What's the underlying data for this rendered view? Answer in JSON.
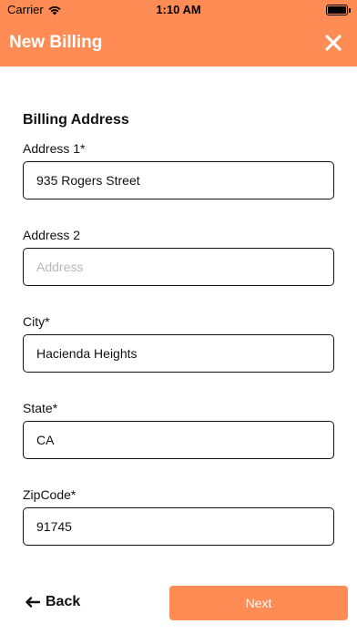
{
  "status_bar": {
    "carrier": "Carrier",
    "time": "1:10 AM",
    "wifi_icon": "wifi-icon",
    "battery_icon": "battery-icon"
  },
  "header": {
    "title": "New Billing",
    "close_icon": "close-icon",
    "background_color": "#ff8c55"
  },
  "form": {
    "section_title": "Billing Address",
    "fields": [
      {
        "label": "Address 1*",
        "value": "935 Rogers Street",
        "placeholder": ""
      },
      {
        "label": "Address 2",
        "value": "",
        "placeholder": "Address"
      },
      {
        "label": "City*",
        "value": "Hacienda Heights",
        "placeholder": ""
      },
      {
        "label": "State*",
        "value": "CA",
        "placeholder": ""
      },
      {
        "label": "ZipCode*",
        "value": "91745",
        "placeholder": ""
      }
    ]
  },
  "footer": {
    "back_label": "Back",
    "back_icon": "arrow-left-icon",
    "next_label": "Next",
    "accent_color": "#ff8c55"
  }
}
